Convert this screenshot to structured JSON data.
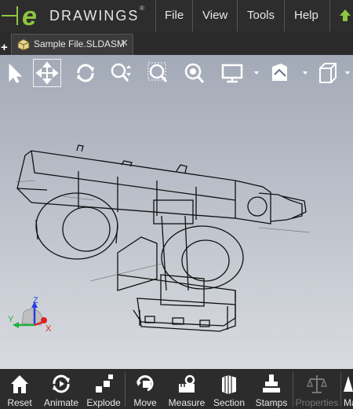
{
  "app": {
    "logo_text": "DRAWINGS",
    "logo_mark": "e",
    "menu": [
      "File",
      "View",
      "Tools",
      "Help"
    ]
  },
  "tabs": [
    {
      "label": "Sample File.SLDASM",
      "close": "✕"
    }
  ],
  "new_tab_symbol": "+",
  "toolbar": {
    "tools": [
      "select",
      "pan",
      "rotate",
      "zoom",
      "zoom-to-area",
      "zoom-to-fit",
      "display-style",
      "appearance",
      "view-orientation"
    ],
    "active_tool": "pan"
  },
  "triad": {
    "x": "X",
    "y": "Y",
    "z": "Z"
  },
  "bottom_toolbar": {
    "buttons": [
      {
        "label": "Reset",
        "enabled": true
      },
      {
        "label": "Animate",
        "enabled": true
      },
      {
        "label": "Explode",
        "enabled": true
      },
      {
        "label": "Move",
        "enabled": true
      },
      {
        "label": "Measure",
        "enabled": true
      },
      {
        "label": "Section",
        "enabled": true
      },
      {
        "label": "Stamps",
        "enabled": true
      },
      {
        "label": "Properties",
        "enabled": false
      },
      {
        "label": "Ma",
        "enabled": true
      }
    ]
  },
  "colors": {
    "titlebar": "#2d2d2d",
    "accent_green": "#8dc63f",
    "viewport_top": "#a3aab7",
    "viewport_bottom": "#d8dbe0",
    "axis_x": "#e02020",
    "axis_y": "#20b040",
    "axis_z": "#2040e0"
  }
}
